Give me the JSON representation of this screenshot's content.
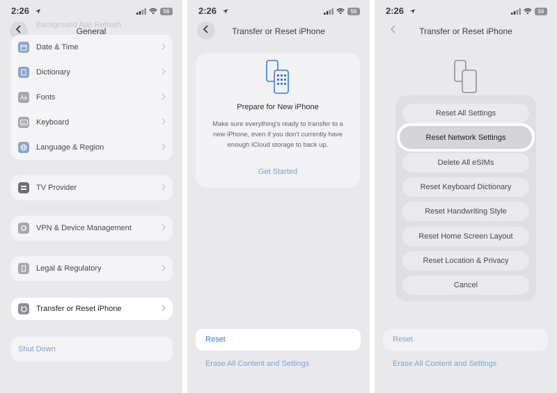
{
  "status": {
    "time": "2:26",
    "battery": "56"
  },
  "panel1": {
    "title": "General",
    "faded_top": "Background App Refresh",
    "group1": [
      "Date & Time",
      "Dictionary",
      "Fonts",
      "Keyboard",
      "Language & Region"
    ],
    "tv_provider": "TV Provider",
    "vpn": "VPN & Device Management",
    "legal": "Legal & Regulatory",
    "transfer": "Transfer or Reset iPhone",
    "shutdown": "Shut Down"
  },
  "panel2": {
    "title": "Transfer or Reset iPhone",
    "card_title": "Prepare for New iPhone",
    "card_desc": "Make sure everything's ready to transfer to a new iPhone, even if you don't currently have enough iCloud storage to back up.",
    "get_started": "Get Started",
    "reset": "Reset",
    "erase": "Erase All Content and Settings"
  },
  "panel3": {
    "title": "Transfer or Reset iPhone",
    "options": [
      "Reset All Settings",
      "Reset Network Settings",
      "Delete All eSIMs",
      "Reset Keyboard Dictionary",
      "Reset Handwriting Style",
      "Reset Home Screen Layout",
      "Reset Location & Privacy",
      "Cancel"
    ],
    "reset": "Reset",
    "erase": "Erase All Content and Settings"
  },
  "colors": {
    "link": "#2f7ee0",
    "dim": "#e9e9ec",
    "highlight": "#ffffff"
  }
}
